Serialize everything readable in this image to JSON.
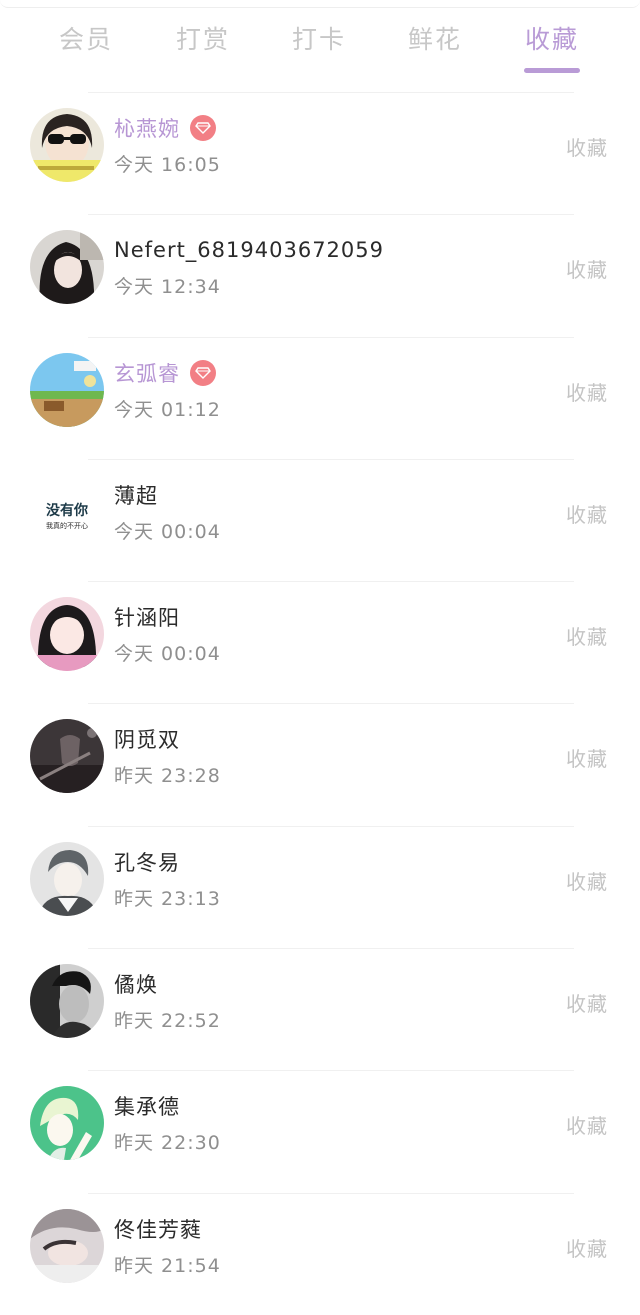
{
  "tabs": [
    {
      "label": "会员"
    },
    {
      "label": "打赏"
    },
    {
      "label": "打卡"
    },
    {
      "label": "鲜花"
    },
    {
      "label": "收藏"
    }
  ],
  "active_tab": "收藏",
  "colors": {
    "accent": "#b99bd6",
    "vip_name": "#b796d4",
    "badge": "#f27f85",
    "inactive_tab": "#c7c7c7",
    "time_text": "#8f8f8f",
    "action_text": "#c4c4c4"
  },
  "items": [
    {
      "name": "杺燕婉",
      "time": "今天 16:05",
      "action": "收藏",
      "vip": true,
      "badge_icon": "diamond-icon"
    },
    {
      "name": "Nefert_6819403672059",
      "time": "今天 12:34",
      "action": "收藏",
      "vip": false
    },
    {
      "name": "玄弧睿",
      "time": "今天 01:12",
      "action": "收藏",
      "vip": true,
      "badge_icon": "diamond-icon"
    },
    {
      "name": "薄超",
      "time": "今天 00:04",
      "action": "收藏",
      "vip": false,
      "avatar_text": [
        "没有你",
        "我真的不开心"
      ]
    },
    {
      "name": "针涵阳",
      "time": "今天 00:04",
      "action": "收藏",
      "vip": false
    },
    {
      "name": "阴觅双",
      "time": "昨天 23:28",
      "action": "收藏",
      "vip": false
    },
    {
      "name": "孔冬易",
      "time": "昨天 23:13",
      "action": "收藏",
      "vip": false
    },
    {
      "name": "僪焕",
      "time": "昨天 22:52",
      "action": "收藏",
      "vip": false
    },
    {
      "name": "集承德",
      "time": "昨天 22:30",
      "action": "收藏",
      "vip": false
    },
    {
      "name": "佟佳芳蕤",
      "time": "昨天 21:54",
      "action": "收藏",
      "vip": false
    }
  ]
}
